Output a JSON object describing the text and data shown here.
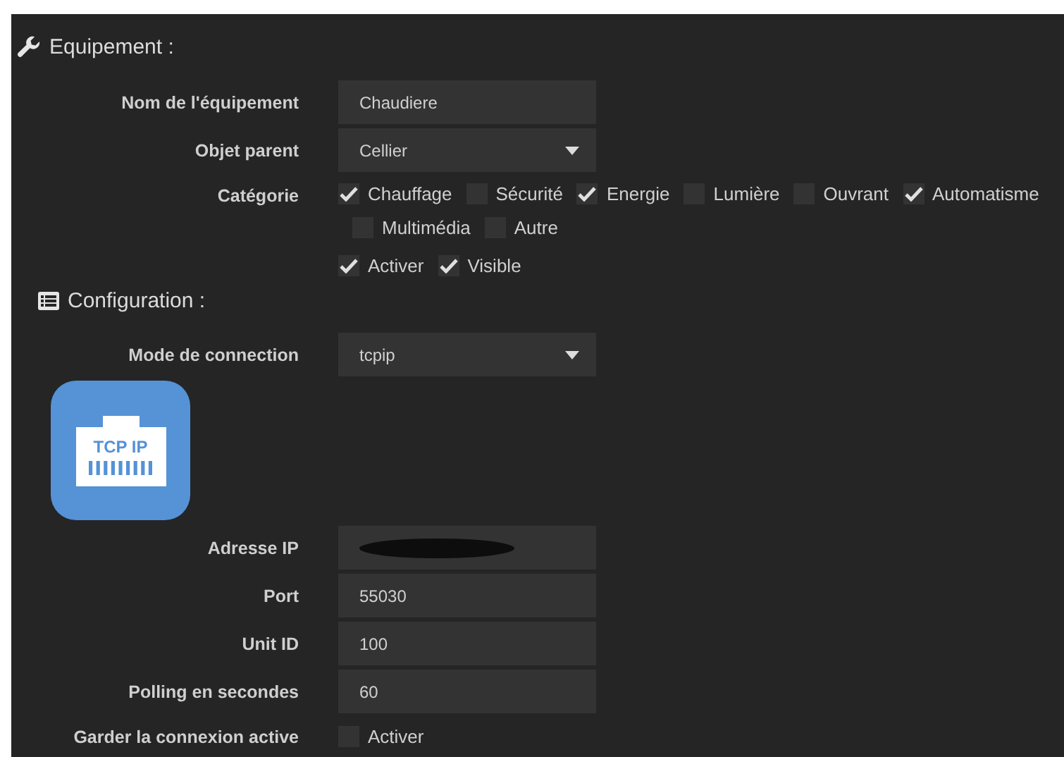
{
  "sections": [
    {
      "kind": "equipment",
      "title": "Equipement :"
    },
    {
      "kind": "configuration",
      "title": "Configuration :"
    }
  ],
  "equipment": {
    "name": {
      "label": "Nom de l'équipement",
      "value": "Chaudiere"
    },
    "parent": {
      "label": "Objet parent",
      "value": "Cellier"
    },
    "category": {
      "label": "Catégorie",
      "lines": [
        {
          "items": [
            {
              "label": "Chauffage",
              "checked": true
            },
            {
              "label": "Sécurité",
              "checked": false
            },
            {
              "label": "Energie",
              "checked": true
            },
            {
              "label": "Lumière",
              "checked": false
            },
            {
              "label": "Ouvrant",
              "checked": false
            },
            {
              "label": "Automatisme",
              "checked": true
            }
          ]
        },
        {
          "items": [
            {
              "label": "Multimédia",
              "checked": false
            },
            {
              "label": "Autre",
              "checked": false
            }
          ]
        }
      ]
    },
    "flags": [
      {
        "label": "Activer",
        "checked": true
      },
      {
        "label": "Visible",
        "checked": true
      }
    ]
  },
  "configuration": {
    "mode": {
      "label": "Mode de connection",
      "value": "tcpip"
    },
    "logo": {
      "text": "TCP IP"
    },
    "fields": [
      {
        "kind": "redacted",
        "label": "Adresse IP"
      },
      {
        "kind": "text",
        "label": "Port",
        "value": "55030"
      },
      {
        "kind": "text",
        "label": "Unit ID",
        "value": "100"
      },
      {
        "kind": "text",
        "label": "Polling en secondes",
        "value": "60"
      }
    ],
    "keep_alive": {
      "label": "Garder la connexion active",
      "option": "Activer",
      "checked": false
    }
  }
}
